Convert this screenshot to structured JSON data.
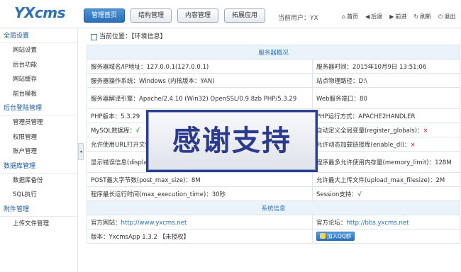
{
  "brand": "YXcms",
  "nav": {
    "items": [
      "管理首页",
      "结构管理",
      "内容管理",
      "拓展应用"
    ],
    "active_index": 0
  },
  "user": {
    "label": "当前用户：YX"
  },
  "toolbar": {
    "home": "首页",
    "back": "后退",
    "forward": "前进",
    "refresh": "刷新",
    "logout": "退出"
  },
  "sidebar": {
    "groups": [
      {
        "title": "全局设置",
        "items": [
          "网站设置",
          "后台功能",
          "网站缓存",
          "前台模板"
        ]
      },
      {
        "title": "后台登陆管理",
        "items": [
          "管理员管理",
          "权限管理",
          "账户管理"
        ]
      },
      {
        "title": "数据库管理",
        "items": [
          "数据库备份",
          "SQL执行"
        ]
      },
      {
        "title": "附件管理",
        "items": [
          "上传文件管理"
        ]
      }
    ]
  },
  "breadcrumb": "当前位置：【环境信息】",
  "server": {
    "heading": "服务器概况",
    "rows": [
      [
        "服务器域名/IP地址：127.0.0.1(127.0.0.1)",
        "服务器时间：2015年10月9日 13:51:06"
      ],
      [
        "服务器操作系统：Windows (内核版本：YAN)",
        "站点物理路径：D:\\"
      ],
      [
        "服务器解译引擎：Apache/2.4.10 (Win32) OpenSSL/0.9.8zb PHP/5.3.29",
        "Web服务端口：80"
      ],
      [
        "PHP版本：5.3.29",
        "PHP运行方式：APACHE2HANDLER"
      ],
      [
        "MySQL数据库：",
        "自动定义全局变量(register_globals)："
      ],
      [
        "允许使用URL打开文件(allow_url_fopen)：",
        "允许动态加载链接库(enable_dl)："
      ],
      [
        "显示错误信息(display_errors)：",
        "程序最多允许使用内存量(memory_limit)：128M"
      ],
      [
        "POST最大字节数(post_max_size)：8M",
        "允许最大上传文件(upload_max_filesize)：2M"
      ],
      [
        "程序最长运行时间(max_execution_time)：30秒",
        "Session支持："
      ]
    ]
  },
  "system": {
    "heading": "系统信息",
    "site_label": "官方网站：",
    "site_url": "http://www.yxcms.net",
    "forum_label": "官方论坛：",
    "forum_url": "http://bbs.yxcms.net",
    "version": "版本：YxcmsApp 1.3.2 【未授权】",
    "qq_button": "加入QQ群"
  },
  "marks": {
    "yes": "√",
    "no": "×"
  },
  "overlay_text": "感谢支持"
}
